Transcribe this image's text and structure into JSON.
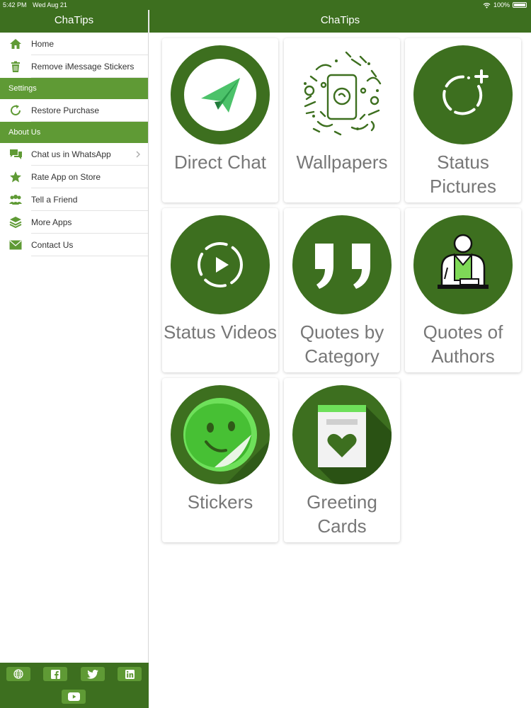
{
  "status_bar": {
    "time": "5:42 PM",
    "date": "Wed Aug 21",
    "battery": "100%"
  },
  "sidebar": {
    "title": "ChaTips",
    "groups": [
      {
        "items": [
          {
            "label": "Home",
            "icon": "home-icon"
          },
          {
            "label": "Remove iMessage Stickers",
            "icon": "trash-icon"
          }
        ]
      },
      {
        "section": "Settings",
        "items": [
          {
            "label": "Restore Purchase",
            "icon": "refresh-icon"
          }
        ]
      },
      {
        "section": "About Us",
        "items": [
          {
            "label": "Chat us in WhatsApp",
            "icon": "chat-bubbles-icon"
          },
          {
            "label": "Rate App on Store",
            "icon": "star-icon"
          },
          {
            "label": "Tell a Friend",
            "icon": "people-icon"
          },
          {
            "label": "More Apps",
            "icon": "layers-icon"
          },
          {
            "label": "Contact Us",
            "icon": "envelope-icon"
          }
        ]
      }
    ],
    "footer_icons": [
      "globe-icon",
      "facebook-icon",
      "twitter-icon",
      "linkedin-icon",
      "youtube-icon"
    ]
  },
  "main": {
    "title": "ChaTips",
    "cards": [
      {
        "title": "Direct Chat",
        "icon": "paper-plane-icon"
      },
      {
        "title": "Wallpapers",
        "icon": "doodle-wallpaper-icon"
      },
      {
        "title": "Status Pictures",
        "icon": "status-add-icon"
      },
      {
        "title": "Status Videos",
        "icon": "status-play-icon"
      },
      {
        "title": "Quotes by Category",
        "icon": "quote-marks-icon"
      },
      {
        "title": "Quotes of Authors",
        "icon": "author-icon"
      },
      {
        "title": "Stickers",
        "icon": "smiley-sticker-icon"
      },
      {
        "title": "Greeting Cards",
        "icon": "greeting-card-icon"
      }
    ]
  },
  "colors": {
    "header": "#3d6f1f",
    "section": "#5f9a35",
    "accent": "#6aa53f",
    "card_text": "#777777"
  }
}
